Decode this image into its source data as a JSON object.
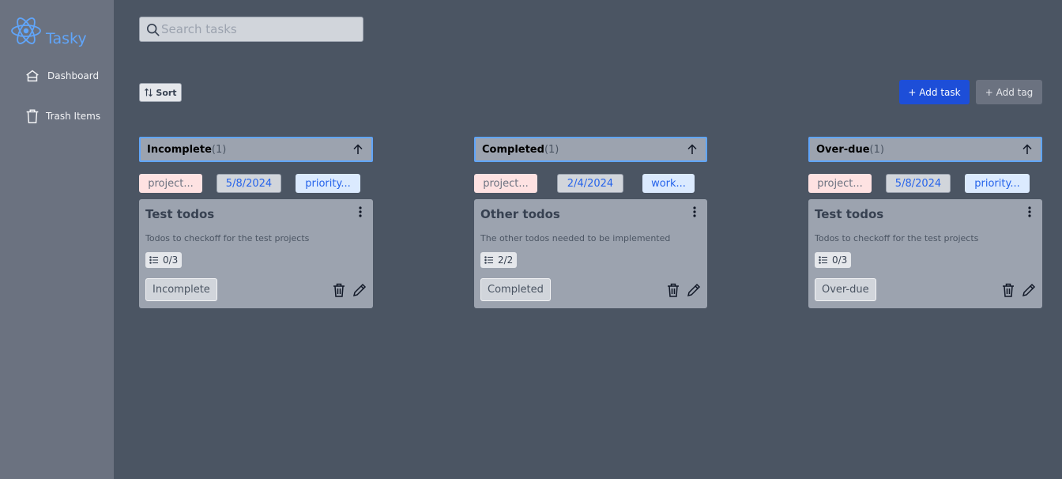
{
  "app": {
    "name": "Tasky"
  },
  "sidebar": {
    "items": [
      {
        "label": "Dashboard",
        "icon": "home-icon"
      },
      {
        "label": "Trash Items",
        "icon": "trash-icon"
      }
    ]
  },
  "search": {
    "placeholder": "Search tasks",
    "value": ""
  },
  "toolbar": {
    "sort_label": "Sort",
    "add_task_label": "+ Add task",
    "add_tag_label": "+ Add tag"
  },
  "colors": {
    "accent": "#60a5fa",
    "primary_button": "#1d4ed8",
    "background": "#4b5563",
    "sidebar": "#6b7280",
    "card": "#9ca3af"
  },
  "columns": [
    {
      "title": "Incomplete",
      "count": "(1)",
      "tags": {
        "project": "project...",
        "date": "5/8/2024",
        "extra": "priority..."
      },
      "card": {
        "title": "Test todos",
        "description": "Todos to checkoff for the test projects",
        "checklist": "0/3",
        "status": "Incomplete"
      }
    },
    {
      "title": "Completed",
      "count": "(1)",
      "tags": {
        "project": "project...",
        "date": "2/4/2024",
        "extra": "work..."
      },
      "card": {
        "title": "Other todos",
        "description": "The other todos needed to be implemented",
        "checklist": "2/2",
        "status": "Completed"
      }
    },
    {
      "title": "Over-due",
      "count": "(1)",
      "tags": {
        "project": "project...",
        "date": "5/8/2024",
        "extra": "priority..."
      },
      "card": {
        "title": "Test todos",
        "description": "Todos to checkoff for the test projects",
        "checklist": "0/3",
        "status": "Over-due"
      }
    }
  ]
}
